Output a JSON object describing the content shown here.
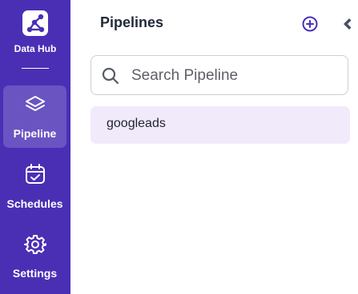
{
  "brand": {
    "label": "Data Hub",
    "icon": "data-hub-logo-icon"
  },
  "sidebar": {
    "items": [
      {
        "label": "Pipeline",
        "icon": "layers-icon",
        "active": true
      },
      {
        "label": "Schedules",
        "icon": "calendar-check-icon",
        "active": false
      },
      {
        "label": "Settings",
        "icon": "gear-icon",
        "active": false
      }
    ]
  },
  "panel": {
    "title": "Pipelines",
    "add_icon": "plus-circle-icon",
    "collapse_icon": "chevron-left-icon"
  },
  "search": {
    "placeholder": "Search Pipeline",
    "value": ""
  },
  "pipelines": [
    {
      "label": "googleads"
    }
  ],
  "colors": {
    "sidebar_bg": "#4a2fb5",
    "accent": "#4a2fb5",
    "selected_item_bg": "#f1eafb"
  }
}
